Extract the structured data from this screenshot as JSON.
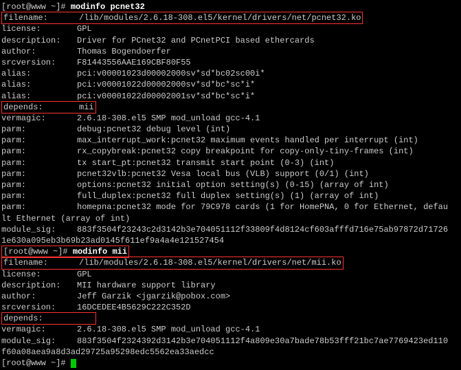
{
  "prompt1": {
    "pre": "[root@www ~]# ",
    "cmd": "modinfo pcnet32"
  },
  "m1": {
    "filename": {
      "k": "filename:",
      "v": "/lib/modules/2.6.18-308.el5/kernel/drivers/net/pcnet32.ko"
    },
    "license": {
      "k": "license:",
      "v": "GPL"
    },
    "description": {
      "k": "description:",
      "v": "Driver for PCnet32 and PCnetPCI based ethercards"
    },
    "author": {
      "k": "author:",
      "v": "Thomas Bogendoerfer"
    },
    "srcversion": {
      "k": "srcversion:",
      "v": "F81443556AAE169CBF80F55"
    },
    "alias1": {
      "k": "alias:",
      "v": "pci:v00001023d00002000sv*sd*bc02sc00i*"
    },
    "alias2": {
      "k": "alias:",
      "v": "pci:v00001022d00002000sv*sd*bc*sc*i*"
    },
    "alias3": {
      "k": "alias:",
      "v": "pci:v00001022d00002001sv*sd*bc*sc*i*"
    },
    "depends": {
      "k": "depends:",
      "v": "mii"
    },
    "vermagic": {
      "k": "vermagic:",
      "v": "2.6.18-308.el5 SMP mod_unload gcc-4.1"
    },
    "parm1": {
      "k": "parm:",
      "v": "debug:pcnet32 debug level (int)"
    },
    "parm2": {
      "k": "parm:",
      "v": "max_interrupt_work:pcnet32 maximum events handled per interrupt (int)"
    },
    "parm3": {
      "k": "parm:",
      "v": "rx_copybreak:pcnet32 copy breakpoint for copy-only-tiny-frames (int)"
    },
    "parm4": {
      "k": "parm:",
      "v": "tx start_pt:pcnet32 transmit start point (0-3) (int)"
    },
    "parm5": {
      "k": "parm:",
      "v": "pcnet32vlb:pcnet32 Vesa local bus (VLB) support (0/1) (int)"
    },
    "parm6": {
      "k": "parm:",
      "v": "options:pcnet32 initial option setting(s) (0-15) (array of int)"
    },
    "parm7": {
      "k": "parm:",
      "v": "full_duplex:pcnet32 full duplex setting(s) (1) (array of int)"
    },
    "parm8": {
      "k": "parm:",
      "v": "homepna:pcnet32 mode for 79C978 cards (1 for HomePNA, 0 for Ethernet, defau"
    },
    "parm8b": "lt Ethernet (array of int)",
    "modsig": {
      "k": "module_sig:",
      "v": "883f3504f23243c2d3142b3e704051112f33809f4d8124cf603afffd716e75ab97872d71726"
    },
    "modsigb": "1e630a095eb3b69b23ad0145f611ef9a4a4e121527454"
  },
  "prompt2": {
    "pre": "[root@www ~]# ",
    "cmd": "modinfo mii"
  },
  "m2": {
    "filename": {
      "k": "filename:",
      "v": "/lib/modules/2.6.18-308.el5/kernel/drivers/net/mii.ko"
    },
    "license": {
      "k": "license:",
      "v": "GPL"
    },
    "description": {
      "k": "description:",
      "v": "MII hardware support library"
    },
    "author": {
      "k": "author:",
      "v": "Jeff Garzik <jgarzik@pobox.com>"
    },
    "srcversion": {
      "k": "srcversion:",
      "v": "16DCEDEE4B5629C222C352D"
    },
    "depends": {
      "k": "depends:",
      "v": ""
    },
    "vermagic": {
      "k": "vermagic:",
      "v": "2.6.18-308.el5 SMP mod_unload gcc-4.1"
    },
    "modsig": {
      "k": "module_sig:",
      "v": "883f3504f2324392d3142b3e704051112f4a809e30a7bade78b53fff21bc7ae7769423ed110"
    },
    "modsigb": "f60a08aea9a8d3ad29725a95298edc5562ea33aedcc"
  },
  "prompt3": {
    "pre": "[root@www ~]# "
  }
}
